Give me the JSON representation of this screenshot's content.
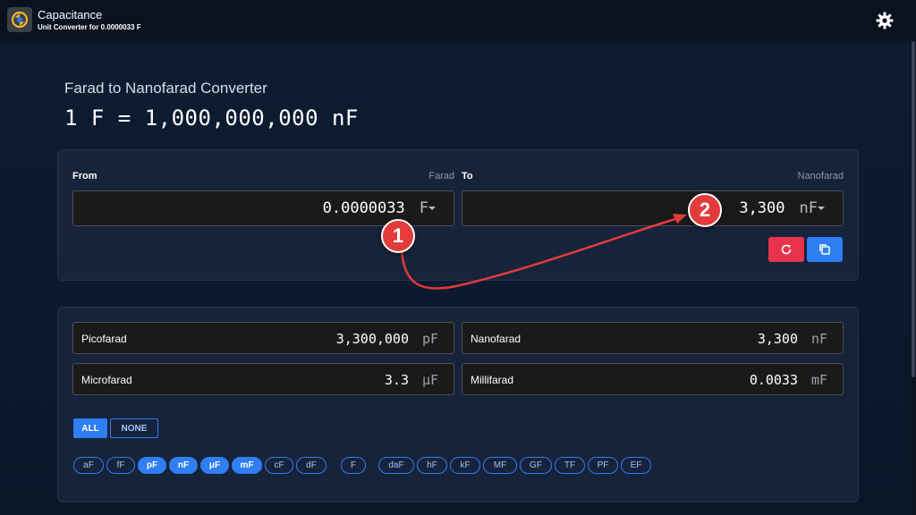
{
  "header": {
    "title": "Capacitance",
    "subtitle": "Unit Converter for 0.0000033 F",
    "logo_icon": "refresh-coin-icon",
    "settings_icon": "gear-icon"
  },
  "converter": {
    "title": "Farad to Nanofarad Converter",
    "formula": "1 F = 1,000,000,000 nF"
  },
  "from": {
    "label": "From",
    "unit_name": "Farad",
    "value": "0.0000033",
    "unit": "F"
  },
  "to": {
    "label": "To",
    "unit_name": "Nanofarad",
    "value": "3,300",
    "unit": "nF"
  },
  "actions": {
    "reset_icon": "reset-icon",
    "copy_icon": "copy-icon"
  },
  "results": [
    {
      "name": "Picofarad",
      "value": "3,300,000",
      "unit": "pF"
    },
    {
      "name": "Nanofarad",
      "value": "3,300",
      "unit": "nF"
    },
    {
      "name": "Microfarad",
      "value": "3.3",
      "unit": "μF"
    },
    {
      "name": "Millifarad",
      "value": "0.0033",
      "unit": "mF"
    }
  ],
  "selection": {
    "all": "ALL",
    "none": "NONE"
  },
  "chips": [
    {
      "label": "aF",
      "on": false
    },
    {
      "label": "fF",
      "on": false
    },
    {
      "label": "pF",
      "on": true
    },
    {
      "label": "nF",
      "on": true
    },
    {
      "label": "μF",
      "on": true
    },
    {
      "label": "mF",
      "on": true
    },
    {
      "label": "cF",
      "on": false
    },
    {
      "label": "dF",
      "on": false
    },
    {
      "label": "F",
      "on": false
    },
    {
      "label": "daF",
      "on": false
    },
    {
      "label": "hF",
      "on": false
    },
    {
      "label": "kF",
      "on": false
    },
    {
      "label": "MF",
      "on": false
    },
    {
      "label": "GF",
      "on": false
    },
    {
      "label": "TF",
      "on": false
    },
    {
      "label": "PF",
      "on": false
    },
    {
      "label": "EF",
      "on": false
    }
  ],
  "annotations": {
    "step1": "1",
    "step2": "2",
    "color": "#e23b3b"
  },
  "colors": {
    "accent": "#2f7ef4",
    "danger": "#e8334c"
  }
}
